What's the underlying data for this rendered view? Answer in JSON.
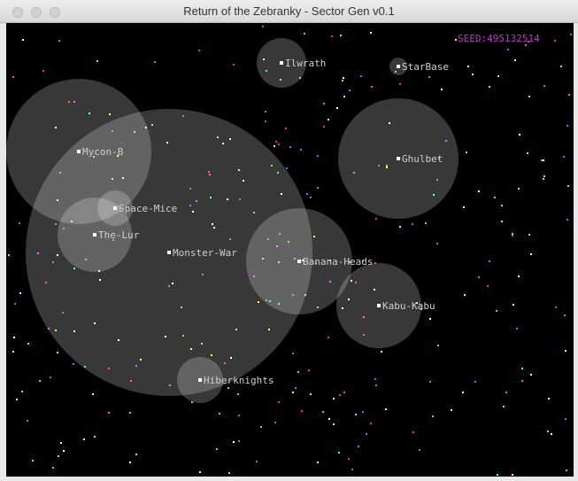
{
  "window": {
    "title": "Return of the Zebranky - Sector Gen v0.1"
  },
  "hud": {
    "seed_text": "SEED:495132514"
  },
  "colors": {
    "sector_fill": "#ffffff",
    "seed": "#c235c8",
    "label": "#cfcfcf",
    "star_palette": [
      "#ff3b3b",
      "#ffff3b",
      "#3bff3b",
      "#3b8bff",
      "#ff3bff",
      "#3bffff",
      "#ffffff"
    ]
  },
  "systems": [
    {
      "name": "Ilwrath"
    },
    {
      "name": "StarBase"
    },
    {
      "name": "Mycon-B"
    },
    {
      "name": "Ghulbet"
    },
    {
      "name": "Space-Mice"
    },
    {
      "name": "The-Lur"
    },
    {
      "name": "Monster-War"
    },
    {
      "name": "Banana-Heads"
    },
    {
      "name": "Kabu-Kabu"
    },
    {
      "name": "Hiberknights"
    }
  ]
}
